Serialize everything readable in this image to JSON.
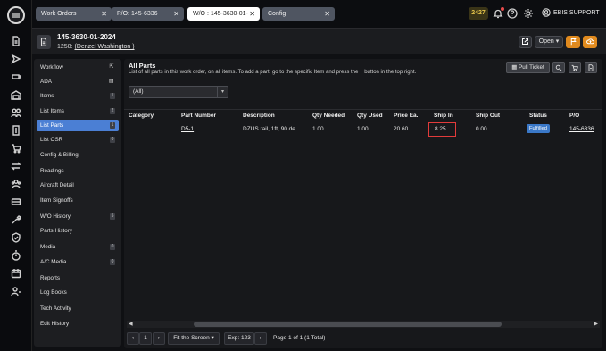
{
  "tabs": [
    {
      "label": "Work Orders",
      "active": false
    },
    {
      "label": "P/O: 145-6336",
      "active": false
    },
    {
      "label": "W/O : 145-3630-01-",
      "active": true
    },
    {
      "label": "Config",
      "active": false
    }
  ],
  "top": {
    "counter": "2427",
    "user": "EBIS SUPPORT",
    "icons": [
      "bell-icon",
      "help-icon",
      "gear-icon",
      "user-icon"
    ]
  },
  "header": {
    "wo_number": "145-3630-01-2024",
    "wo_prefix": "1258:",
    "wo_customer": "(Denzel Washington )",
    "open_label": "Open"
  },
  "menu": {
    "items": [
      {
        "label": "Workflow",
        "badge": "⇱",
        "active": false
      },
      {
        "label": "ADA",
        "badge": "▤",
        "active": false
      },
      {
        "label": "Items",
        "badge": "1",
        "active": false
      },
      {
        "label": "List Items",
        "badge": "2",
        "active": false
      },
      {
        "label": "List Parts",
        "badge": "1",
        "active": true
      },
      {
        "label": "List OSR",
        "badge": "0",
        "active": false
      },
      {
        "label": "Config & Billing",
        "badge": "",
        "active": false
      },
      {
        "label": "Readings",
        "badge": "",
        "active": false
      },
      {
        "label": "Aircraft Detail",
        "badge": "",
        "active": false
      },
      {
        "label": "Item Signoffs",
        "badge": "",
        "active": false
      },
      {
        "label": "W/O History",
        "badge": "5",
        "active": false
      },
      {
        "label": "Parts History",
        "badge": "",
        "active": false
      },
      {
        "label": "Media",
        "badge": "0",
        "active": false
      },
      {
        "label": "A/C Media",
        "badge": "0",
        "active": false
      },
      {
        "label": "Reports",
        "badge": "",
        "active": false
      },
      {
        "label": "Log Books",
        "badge": "",
        "active": false
      },
      {
        "label": "Tech Activity",
        "badge": "",
        "active": false
      },
      {
        "label": "Edit History",
        "badge": "",
        "active": false
      }
    ]
  },
  "panel": {
    "title": "All Parts",
    "description": "List of all parts in this work order, on all items. To add a part, go to the specific Item and press the + button in the top right.",
    "pull_ticket_label": "Pull Ticket",
    "filter_value": "(All)",
    "columns": [
      "Category",
      "Part Number",
      "Description",
      "Qty Needed",
      "Qty Used",
      "Price Ea.",
      "Ship In",
      "Ship Out",
      "Status",
      "P/O"
    ],
    "rows": [
      {
        "category": "",
        "part_number": "D5-1",
        "description": "DZUS rail, 1ft, 90 de...",
        "qty_needed": "1.00",
        "qty_used": "1.00",
        "price": "20.60",
        "ship_in": "8.25",
        "ship_out": "0.00",
        "status": "Fulfilled",
        "po": "145-6336"
      }
    ]
  },
  "pager": {
    "page": "1",
    "fit_label": "Fit the Screen",
    "exp_label": "Exp: 123",
    "summary": "Page 1 of 1 (1 Total)"
  },
  "colors": {
    "accent": "#4b7fd4",
    "orange": "#e08a1e",
    "status": "#3a78c8",
    "highlight": "#e23b3b"
  }
}
